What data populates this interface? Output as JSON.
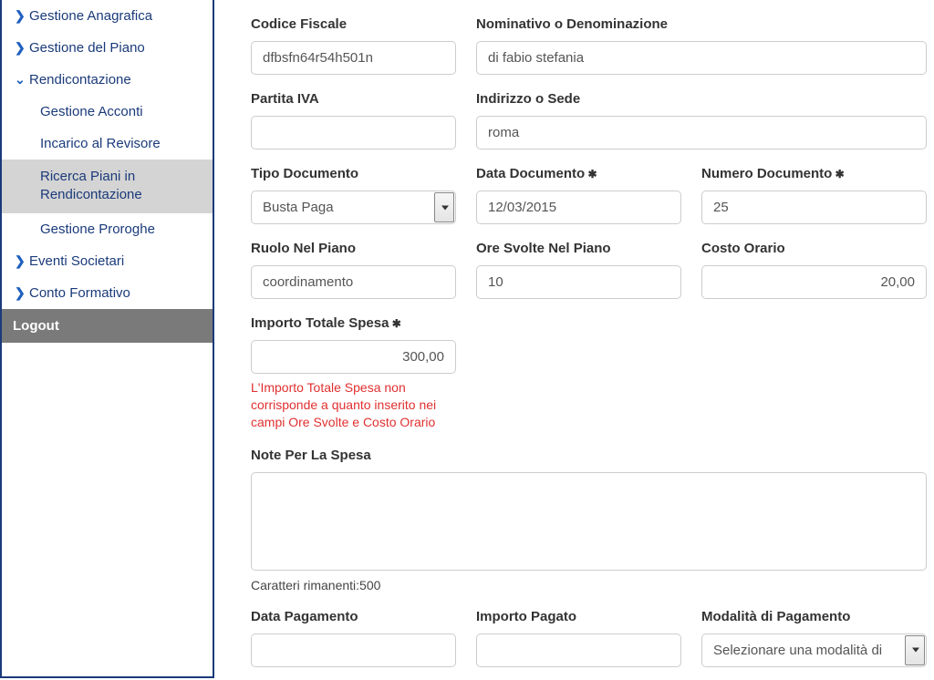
{
  "sidebar": {
    "items": [
      {
        "label": "Gestione Anagrafica",
        "icon": "chevron-right"
      },
      {
        "label": "Gestione del Piano",
        "icon": "chevron-right"
      },
      {
        "label": "Rendicontazione",
        "icon": "chevron-down"
      },
      {
        "label": "Gestione Acconti",
        "sub": true
      },
      {
        "label": "Incarico al Revisore",
        "sub": true
      },
      {
        "label": "Ricerca Piani in Rendicontazione",
        "sub": true,
        "active": true
      },
      {
        "label": "Gestione Proroghe",
        "sub": true
      },
      {
        "label": "Eventi Societari",
        "icon": "chevron-right"
      },
      {
        "label": "Conto Formativo",
        "icon": "chevron-right"
      }
    ],
    "logout_label": "Logout"
  },
  "form": {
    "codice_fiscale": {
      "label": "Codice Fiscale",
      "value": "dfbsfn64r54h501n"
    },
    "nominativo": {
      "label": "Nominativo o Denominazione",
      "value": "di fabio stefania"
    },
    "partita_iva": {
      "label": "Partita IVA",
      "value": ""
    },
    "indirizzo": {
      "label": "Indirizzo o Sede",
      "value": "roma"
    },
    "tipo_documento": {
      "label": "Tipo Documento",
      "value": "Busta Paga"
    },
    "data_documento": {
      "label": "Data Documento",
      "value": "12/03/2015"
    },
    "numero_documento": {
      "label": "Numero Documento",
      "value": "25"
    },
    "ruolo": {
      "label": "Ruolo Nel Piano",
      "value": "coordinamento"
    },
    "ore_svolte": {
      "label": "Ore Svolte Nel Piano",
      "value": "10"
    },
    "costo_orario": {
      "label": "Costo Orario",
      "value": "20,00"
    },
    "importo_totale": {
      "label": "Importo Totale Spesa",
      "value": "300,00",
      "error": "L'Importo Totale Spesa non corrisponde a quanto inserito nei campi Ore Svolte e Costo Orario"
    },
    "note": {
      "label": "Note Per La Spesa",
      "value": "",
      "hint": "Caratteri rimanenti:500"
    },
    "data_pagamento": {
      "label": "Data Pagamento",
      "value": ""
    },
    "importo_pagato": {
      "label": "Importo Pagato",
      "value": ""
    },
    "modalita_pagamento": {
      "label": "Modalità di Pagamento",
      "value": "Selezionare una modalità di"
    }
  }
}
